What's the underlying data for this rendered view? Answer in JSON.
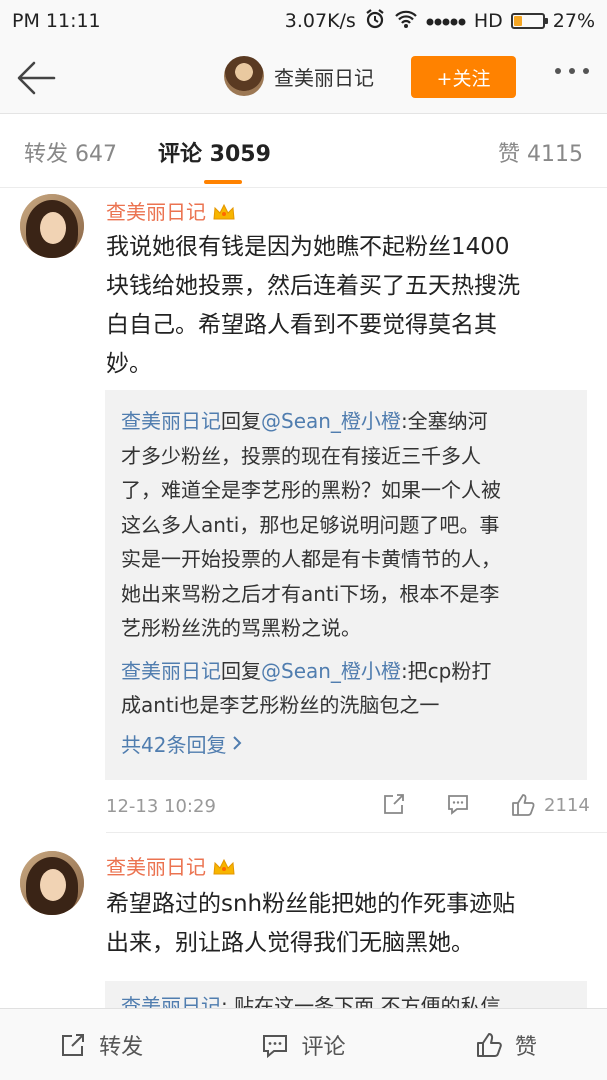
{
  "status_bar": {
    "time": "PM  11:11",
    "speed": "3.07K/s",
    "network": "HD",
    "battery": "27%",
    "battery_level": 0.27
  },
  "header": {
    "title": "查美丽日记",
    "follow_label": "+关注"
  },
  "tabs": [
    {
      "label": "转发 647"
    },
    {
      "label": "评论 3059"
    },
    {
      "label": "赞 4115"
    }
  ],
  "comments": [
    {
      "author": "查美丽日记",
      "lines": [
        "我说她很有钱是因为她瞧不起粉丝1400",
        "块钱给她投票，然后连着买了五天热搜洗",
        "白自己。希望路人看到不要觉得莫名其",
        "妙。"
      ],
      "replies": [
        {
          "author": "查美丽日记",
          "reply_word": "回复",
          "target": "@Sean_橙小橙",
          "lines": [
            ":全塞纳河",
            "才多少粉丝，投票的现在有接近三千多人",
            "了，难道全是李艺彤的黑粉？如果一个人被",
            "这么多人anti，那也足够说明问题了吧。事",
            "实是一开始投票的人都是有卡黄情节的人，",
            "她出来骂粉之后才有anti下场，根本不是李",
            "艺彤粉丝洗的骂黑粉之说。"
          ]
        },
        {
          "author": "查美丽日记",
          "reply_word": "回复",
          "target": "@Sean_橙小橙",
          "lines": [
            ":把cp粉打",
            "成anti也是李艺彤粉丝的洗脑包之一"
          ]
        }
      ],
      "more_replies": "共42条回复",
      "time": "12-13 10:29",
      "likes": "2114"
    },
    {
      "author": "查美丽日记",
      "lines": [
        "希望路过的snh粉丝能把她的作死事迹贴",
        "出来，别让路人觉得我们无脑黑她。"
      ],
      "replies": [
        {
          "author": "查美丽日记",
          "reply_word": "",
          "target": "",
          "lines": [
            ": 贴在这一条下面 不方便的私信"
          ]
        }
      ]
    }
  ],
  "bottom_bar": {
    "repost": "转发",
    "comment": "评论",
    "like": "赞"
  },
  "colors": {
    "accent": "#ff8200",
    "link": "#507daf",
    "author": "#eb7350"
  }
}
